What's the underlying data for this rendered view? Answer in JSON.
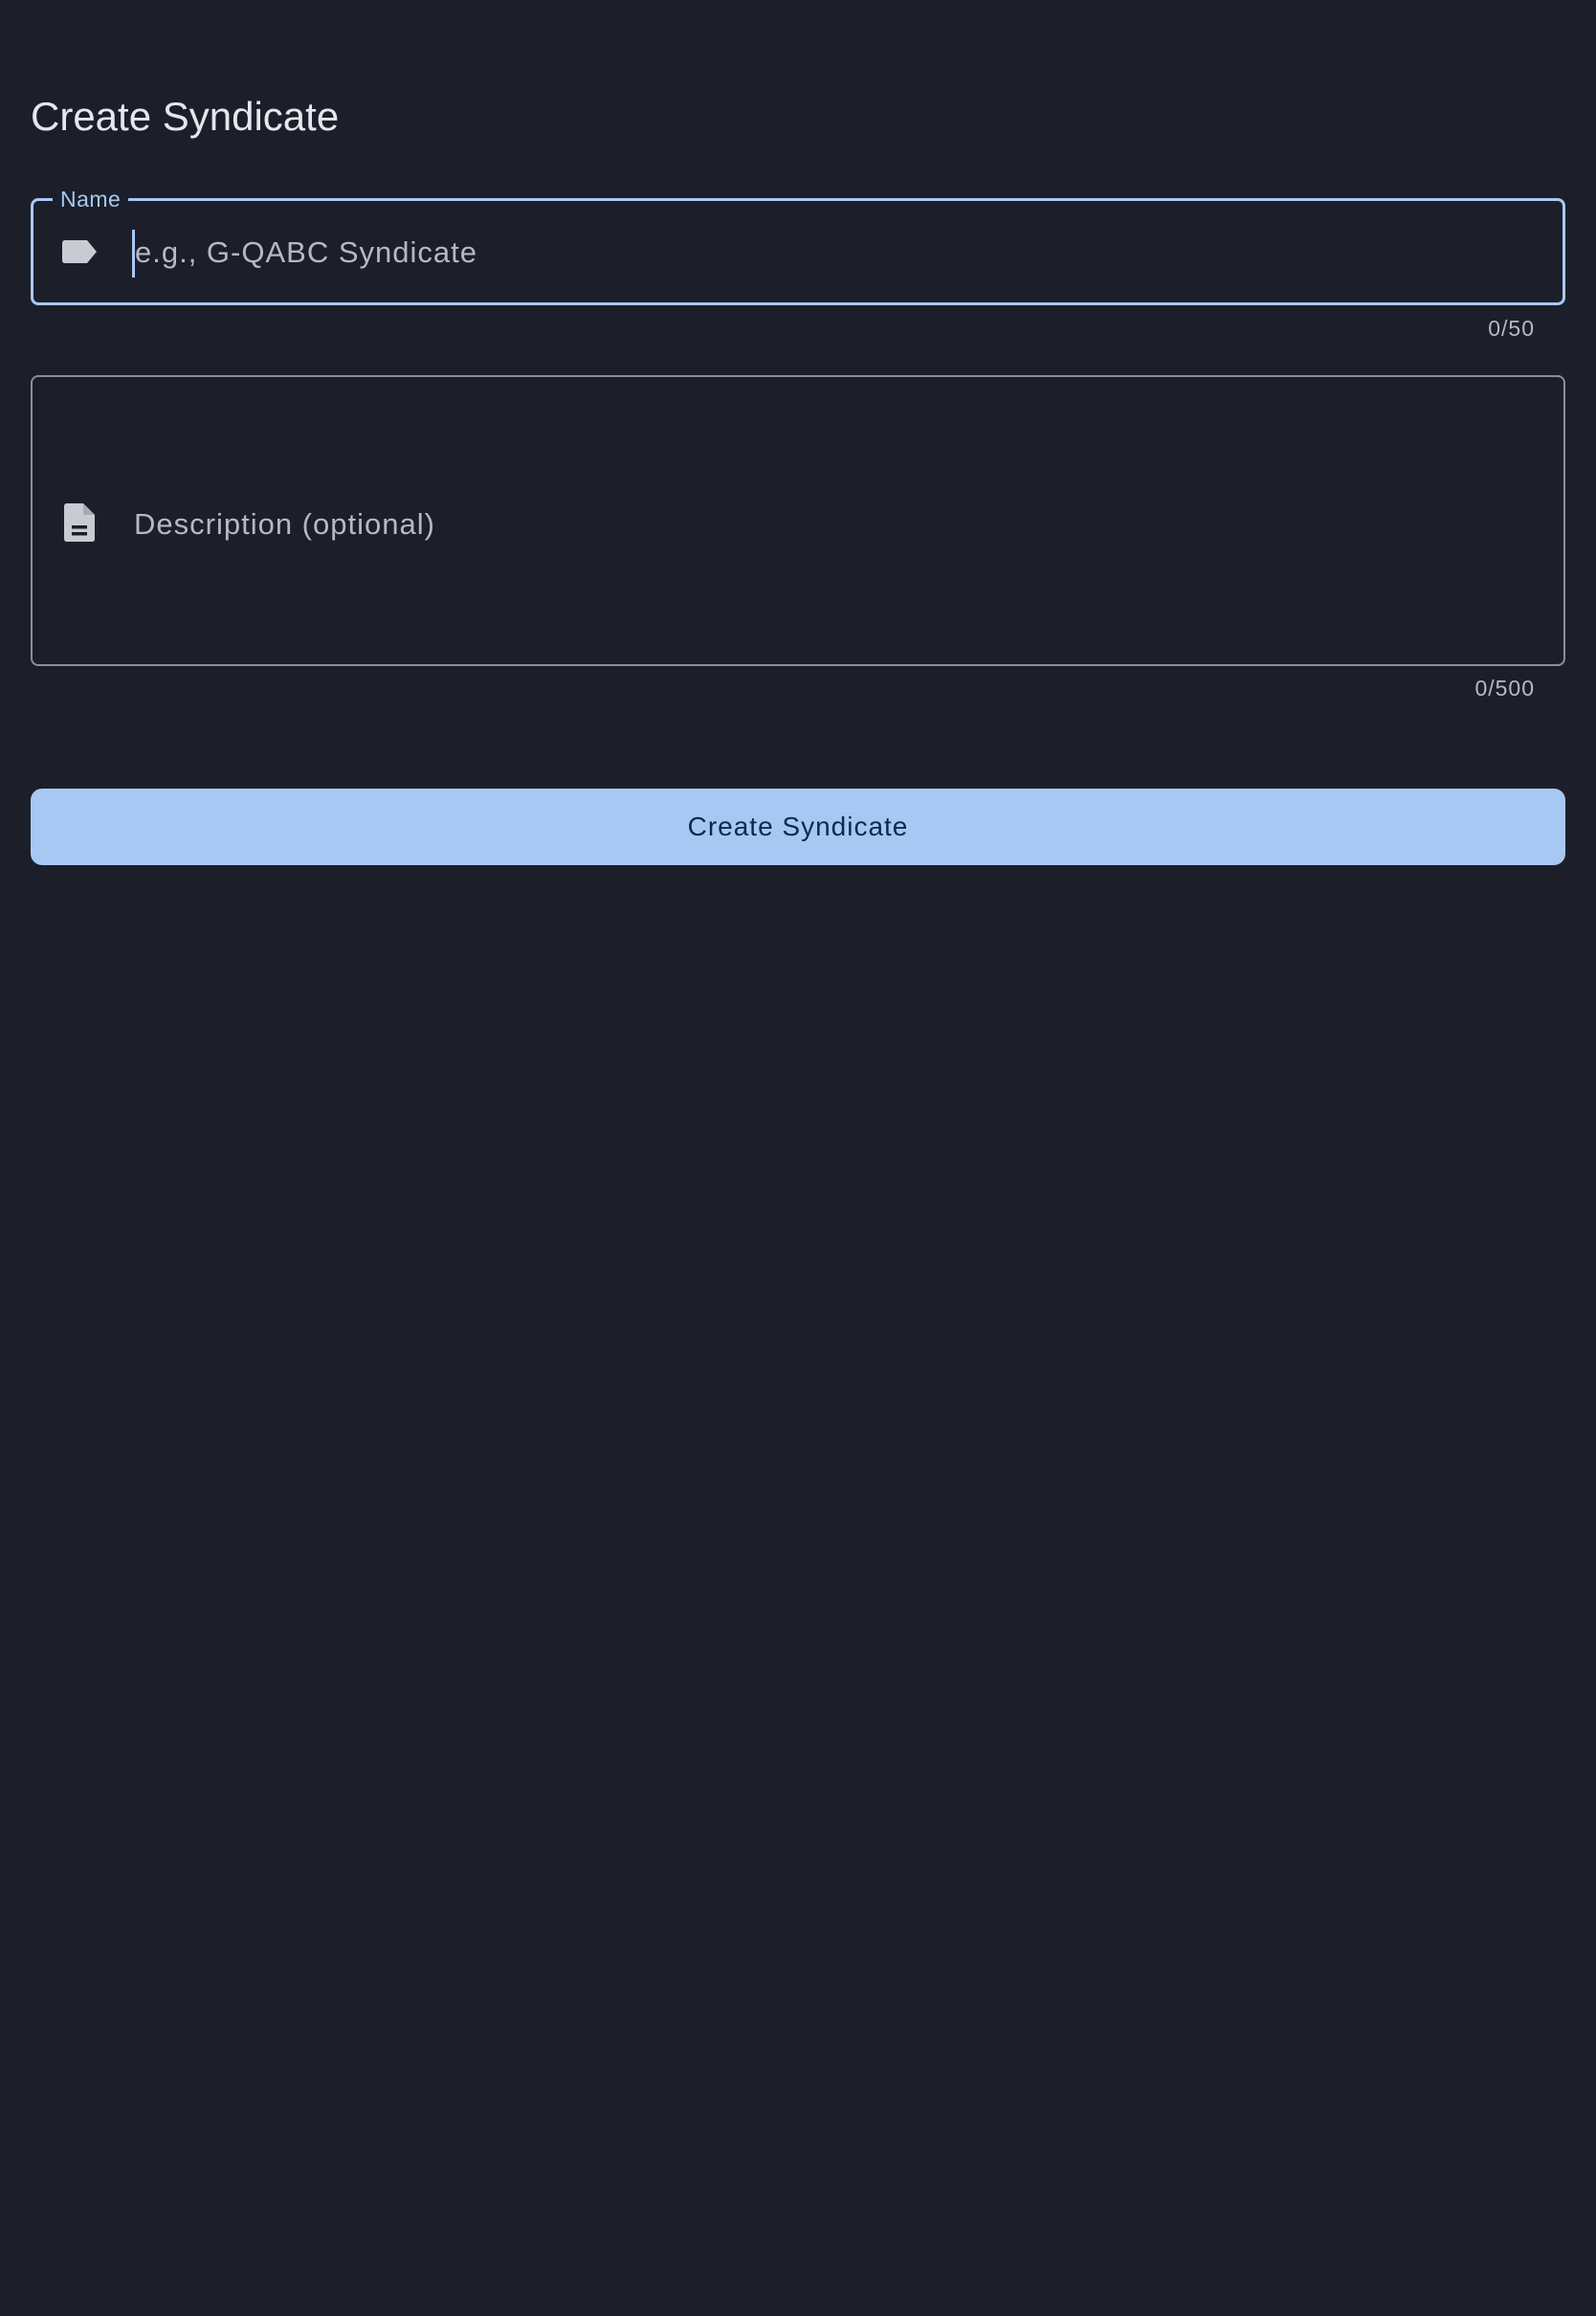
{
  "page": {
    "title": "Create Syndicate"
  },
  "name_field": {
    "label": "Name",
    "placeholder": "e.g., G-QABC Syndicate",
    "value": "",
    "counter": "0/50",
    "icon": "label-tag-icon",
    "accent_color": "#a8c8f4"
  },
  "description_field": {
    "placeholder": "Description (optional)",
    "value": "",
    "counter": "0/500",
    "icon": "description-document-icon"
  },
  "actions": {
    "create_label": "Create Syndicate"
  },
  "theme": {
    "background": "#1c1f29",
    "primary": "#a8c8f4",
    "on_primary": "#0d2a4e",
    "outline": "#8c8e98"
  }
}
